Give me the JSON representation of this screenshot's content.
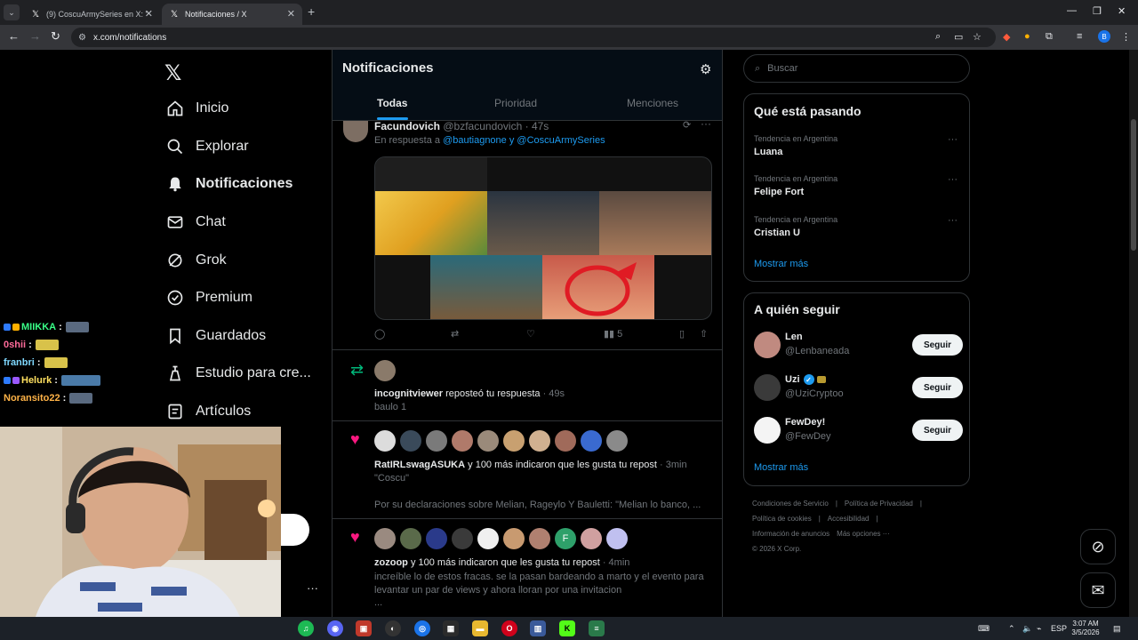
{
  "browser": {
    "tabs": [
      {
        "title": "(9) CoscuArmySeries en X: \"",
        "active": false
      },
      {
        "title": "Notificaciones / X",
        "active": true
      }
    ],
    "url": "x.com/notifications"
  },
  "sidebar": {
    "items": [
      {
        "label": "Inicio",
        "icon": "home-icon"
      },
      {
        "label": "Explorar",
        "icon": "search-icon"
      },
      {
        "label": "Notificaciones",
        "icon": "bell-icon",
        "active": true
      },
      {
        "label": "Chat",
        "icon": "mail-icon"
      },
      {
        "label": "Grok",
        "icon": "grok-icon"
      },
      {
        "label": "Premium",
        "icon": "verified-icon"
      },
      {
        "label": "Guardados",
        "icon": "bookmark-icon"
      },
      {
        "label": "Estudio para cre...",
        "icon": "studio-icon"
      },
      {
        "label": "Artículos",
        "icon": "article-icon"
      }
    ],
    "more_label": "···"
  },
  "stream_chat": [
    {
      "user": "MIIKKA",
      "color": "#39ff88"
    },
    {
      "user": "0shii",
      "color": "#ff6b9a"
    },
    {
      "user": "franbri",
      "color": "#7fd8ff"
    },
    {
      "user": "Helurk",
      "color": "#ffe060"
    },
    {
      "user": "Noransito22",
      "color": "#ffb347"
    }
  ],
  "notifications": {
    "title": "Notificaciones",
    "tabs": [
      "Todas",
      "Prioridad",
      "Menciones"
    ],
    "reply_tweet": {
      "author": "Facundovich",
      "handle": "@bzfacundovich",
      "time": "· 47s",
      "reply_prefix": "En respuesta a",
      "reply_to_1": "@bautiagnone",
      "reply_and": "y",
      "reply_to_2": "@CoscuArmySeries",
      "views": "5"
    },
    "repost": {
      "user": "incognitviewer",
      "action": "reposteó tu respuesta",
      "time": "· 49s",
      "text": "baulo 1"
    },
    "like1": {
      "user": "RatIRLswagASUKA",
      "action": "y 100 más indicaron que les gusta tu repost",
      "time": "· 3min",
      "quote": "\"Coscu\"",
      "text": "Por su declaraciones sobre Melian, Rageylo Y Bauletti: \"Melian lo banco, ..."
    },
    "like2": {
      "user": "zozoop",
      "action": "y 100 más indicaron que les gusta tu repost",
      "time": "· 4min",
      "text": "increíble lo de estos fracas. se la pasan bardeando a marto y el evento para levantar un par de views y  ahora lloran por una invitacion",
      "ellipsis": "..."
    }
  },
  "right": {
    "search_placeholder": "Buscar",
    "trending_title": "Qué está pasando",
    "trends": [
      {
        "category": "Tendencia en Argentina",
        "name": "Luana"
      },
      {
        "category": "Tendencia en Argentina",
        "name": "Felipe Fort"
      },
      {
        "category": "Tendencia en Argentina",
        "name": "Cristian U"
      }
    ],
    "show_more": "Mostrar más",
    "follow_title": "A quién seguir",
    "follow": [
      {
        "name": "Len",
        "handle": "@Lenbaneada",
        "button": "Seguir",
        "verified": false
      },
      {
        "name": "Uzi",
        "handle": "@UziCryptoo",
        "button": "Seguir",
        "verified": true
      },
      {
        "name": "FewDey!",
        "handle": "@FewDey",
        "button": "Seguir",
        "verified": false
      }
    ],
    "follow_more": "Mostrar más",
    "footer": {
      "terms": "Condiciones de Servicio",
      "privacy": "Política de Privacidad",
      "cookies": "Política de cookies",
      "accessibility": "Accesibilidad",
      "ads": "Información de anuncios",
      "more": "Más opciones ···",
      "copyright": "© 2026 X Corp."
    }
  },
  "taskbar": {
    "lang": "ESP",
    "time": "3:07 AM",
    "date": "3/5/2026"
  },
  "colors": {
    "accent": "#1d9bf0",
    "like": "#f91880",
    "repost": "#00ba7c"
  }
}
